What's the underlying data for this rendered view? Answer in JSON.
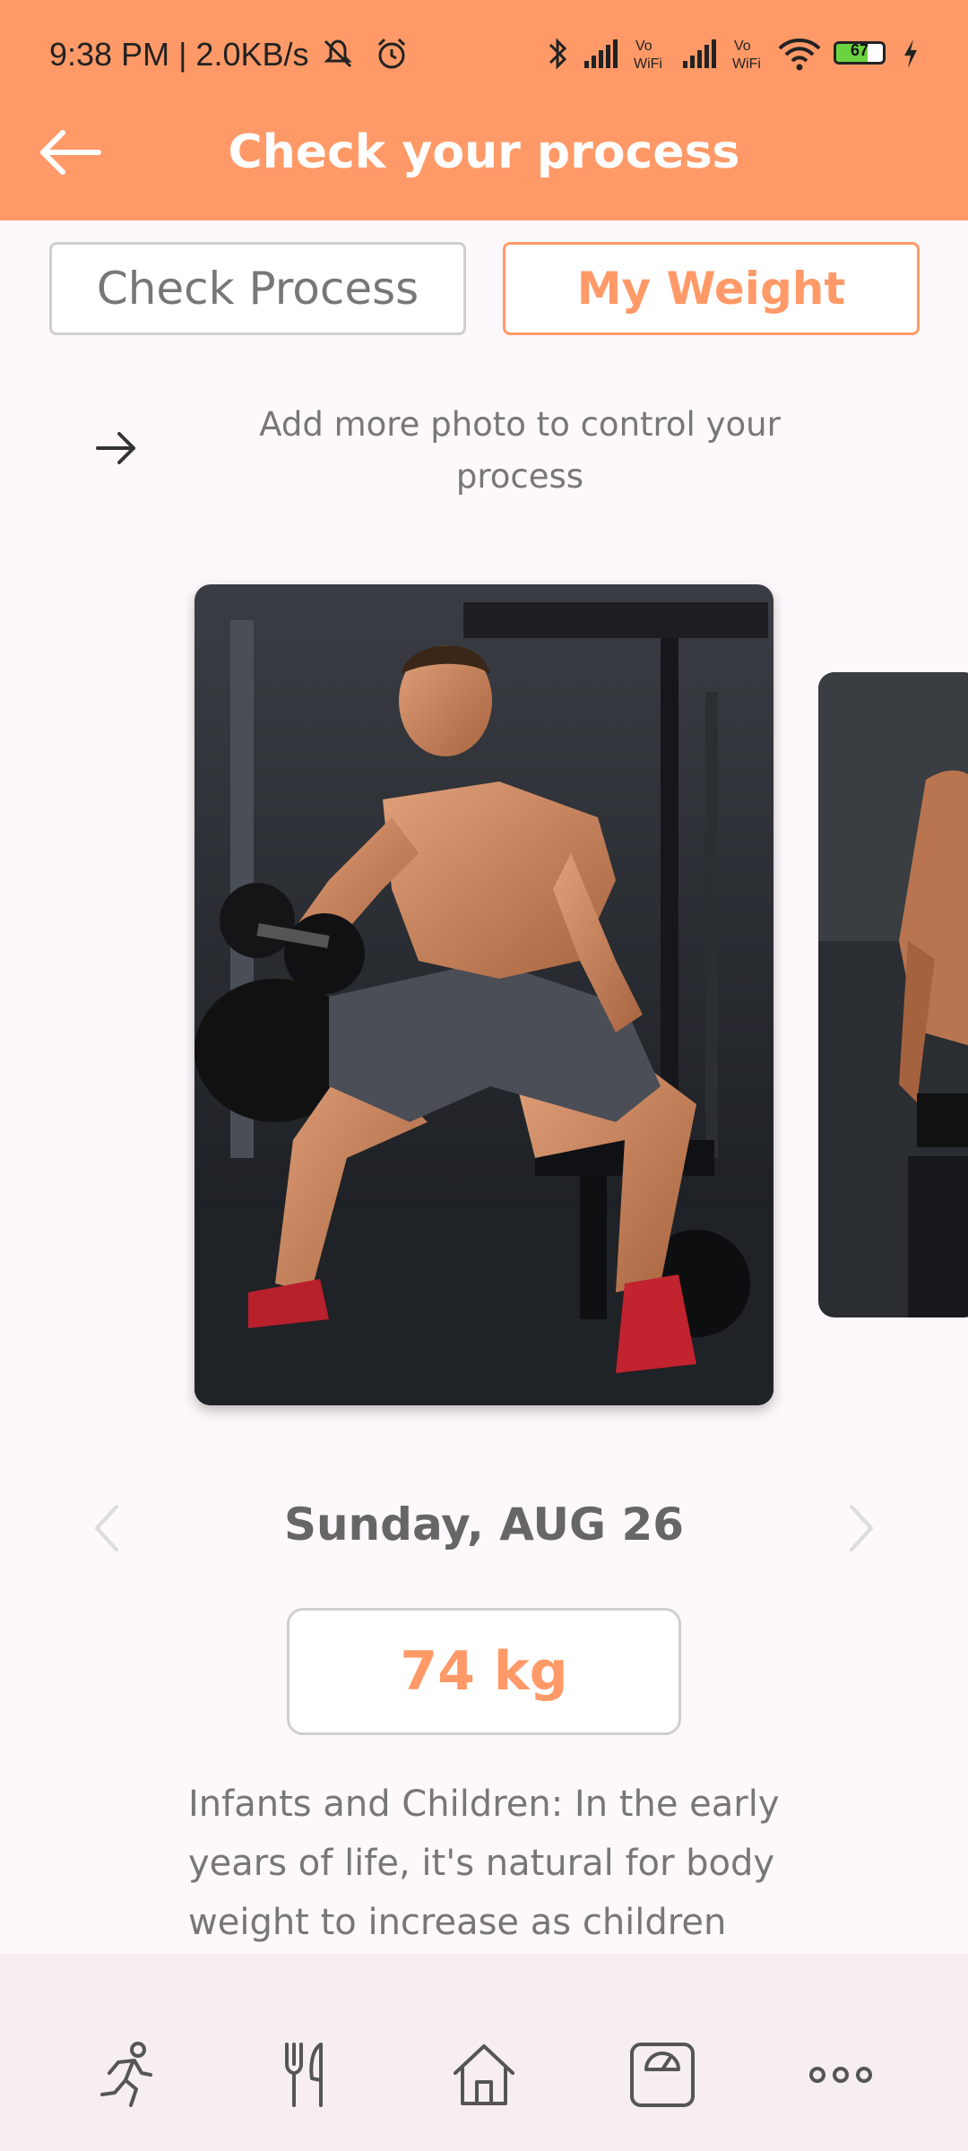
{
  "status_bar": {
    "time": "9:38 PM | 2.0KB/s",
    "battery_level": "67",
    "battery_fraction": 0.67,
    "icons": [
      "mute-icon",
      "alarm-icon",
      "bluetooth-icon",
      "signal-icon",
      "vowifi-icon",
      "signal-icon",
      "vowifi-icon",
      "wifi-icon",
      "battery-icon",
      "charging-icon"
    ]
  },
  "header": {
    "title": "Check your process",
    "back_icon": "arrow-left-icon"
  },
  "tabs": [
    {
      "label": "Check Process",
      "active": false
    },
    {
      "label": "My Weight",
      "active": true
    }
  ],
  "hint": {
    "text": "Add more photo to control your process",
    "icon": "arrow-right-icon"
  },
  "entry": {
    "date": "Sunday, AUG 26",
    "weight": "74 kg"
  },
  "description": "Infants and Children: In the early years of life, it's natural for body weight to increase as children",
  "bottom_nav": [
    "runner-icon",
    "fork-knife-icon",
    "home-icon",
    "scale-icon",
    "more-icon"
  ],
  "colors": {
    "accent": "#ff9a68",
    "background": "#fdf8fb",
    "nav_background": "#f6eeef"
  }
}
